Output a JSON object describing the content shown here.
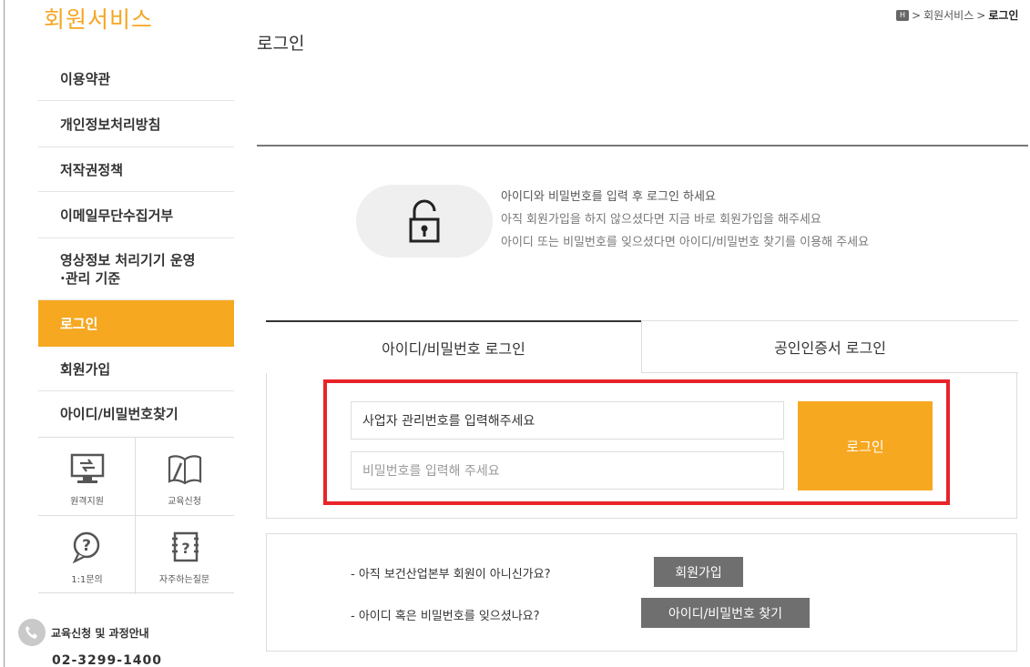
{
  "sidebar": {
    "title": "회원서비스",
    "menu": [
      {
        "label": "이용약관",
        "active": false
      },
      {
        "label": "개인정보처리방침",
        "active": false
      },
      {
        "label": "저작권정책",
        "active": false
      },
      {
        "label": "이메일무단수집거부",
        "active": false
      },
      {
        "label": "영상정보 처리기기 운영\n·관리 기준",
        "active": false
      },
      {
        "label": "로그인",
        "active": true
      },
      {
        "label": "회원가입",
        "active": false
      },
      {
        "label": "아이디/비밀번호찾기",
        "active": false
      }
    ],
    "quick_links": [
      {
        "label": "원격지원",
        "icon": "monitor-icon"
      },
      {
        "label": "교육신청",
        "icon": "book-icon"
      },
      {
        "label": "1:1문의",
        "icon": "question-bubble-icon"
      },
      {
        "label": "자주하는질문",
        "icon": "faq-note-icon"
      }
    ],
    "edu": {
      "label": "교육신청 및 과정안내",
      "phone": "02-3299-1400",
      "icon": "phone-icon"
    }
  },
  "header": {
    "page_title": "로그인",
    "breadcrumb": [
      "회원서비스",
      "로그인"
    ]
  },
  "info": {
    "lines": [
      "아이디와 비밀번호를 입력 후 로그인 하세요",
      "아직 회원가입을 하지 않으셨다면 지금 바로 회원가입을 해주세요",
      "아이디 또는 비밀번호를 잊으셨다면 아이디/비밀번호 찾기를 이용해 주세요"
    ],
    "icon": "unlock-icon"
  },
  "login": {
    "tabs": [
      "아이디/비밀번호 로그인",
      "공인인증서 로그인"
    ],
    "id_value": "사업자 관리번호를 입력해주세요",
    "password_placeholder": "비밀번호를 입력해 주세요",
    "submit_label": "로그인",
    "highlight_color": "#e8232a",
    "accent_color": "#f7a821"
  },
  "help": {
    "signup_question": "- 아직 보건산업본부 회원이 아니신가요?",
    "signup_button": "회원가입",
    "find_question": "- 아이디 혹은 비밀번호를 잊으셨나요?",
    "find_button": "아이디/비밀번호 찾기"
  }
}
